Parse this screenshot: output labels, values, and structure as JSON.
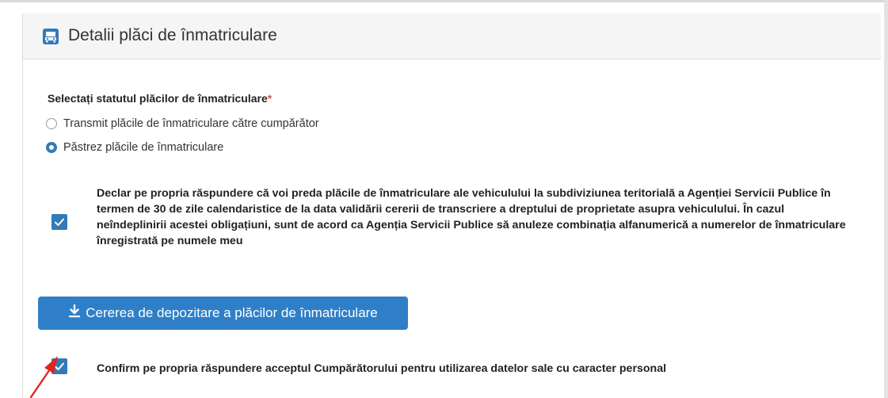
{
  "panel": {
    "title": "Detalii plăci de înmatriculare",
    "icon": "car-icon"
  },
  "plate_status": {
    "label": "Selectați statutul plăcilor de înmatriculare",
    "required_mark": "*",
    "options": [
      {
        "label": "Transmit plăcile de înmatriculare către cumpărător",
        "selected": false
      },
      {
        "label": "Păstrez plăcile de înmatriculare",
        "selected": true
      }
    ]
  },
  "declaration": {
    "checked": true,
    "text": "Declar pe propria răspundere că voi preda plăcile de înmatriculare ale vehiculului la subdiviziunea teritorială a Agenției Servicii Publice în termen de 30 de zile calendaristice de la data validării cererii de transcriere a dreptului de proprietate asupra vehiculului. În cazul neîndeplinirii acestei obligațiuni, sunt de acord ca Agenția Servicii Publice să anuleze combinația alfanumerică a numerelor de înmatriculare înregistrată pe numele meu"
  },
  "download_button": {
    "label": "Cererea de depozitare a plăcilor de înmatriculare",
    "icon": "download-icon",
    "color": "#2f7fc8"
  },
  "confirmation": {
    "checked": true,
    "text": "Confirm pe propria răspundere acceptul Cumpărătorului pentru utilizarea datelor sale cu caracter personal"
  },
  "colors": {
    "accent": "#337ab7",
    "annotation_arrow": "#e0261c",
    "required": "#d9534f"
  }
}
